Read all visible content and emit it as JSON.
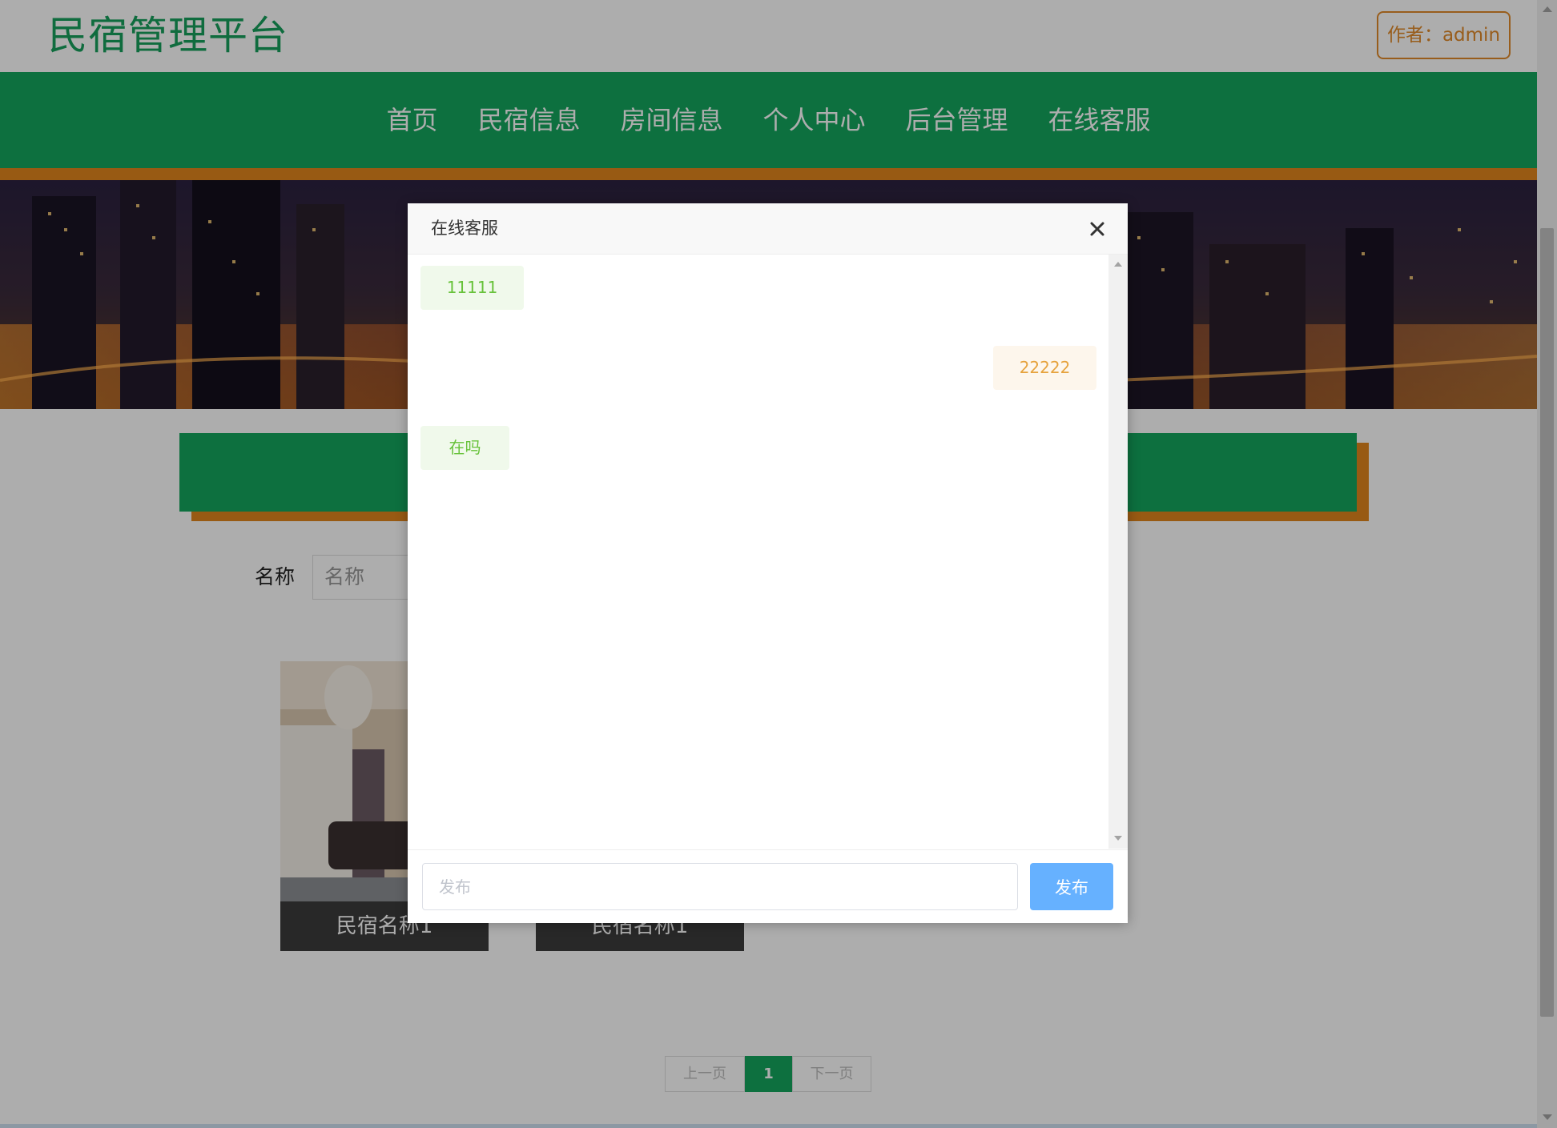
{
  "header": {
    "logo": "民宿管理平台",
    "author_label": "作者：admin"
  },
  "nav": {
    "items": [
      {
        "label": "首页"
      },
      {
        "label": "民宿信息"
      },
      {
        "label": "房间信息"
      },
      {
        "label": "个人中心"
      },
      {
        "label": "后台管理"
      },
      {
        "label": "在线客服"
      }
    ]
  },
  "search": {
    "label": "名称",
    "placeholder": "名称"
  },
  "cards": [
    {
      "title": "民宿名称1"
    },
    {
      "title": "民宿名称1"
    }
  ],
  "pagination": {
    "prev": "上一页",
    "current": "1",
    "next": "下一页"
  },
  "dialog": {
    "title": "在线客服",
    "messages": [
      {
        "side": "left",
        "text": "11111"
      },
      {
        "side": "right",
        "text": "22222"
      },
      {
        "side": "left",
        "text": "在吗"
      }
    ],
    "input_placeholder": "发布",
    "send_label": "发布"
  },
  "colors": {
    "brand_green": "#14a55d",
    "accent_orange": "#e0851c",
    "send_blue": "#66b1ff"
  }
}
